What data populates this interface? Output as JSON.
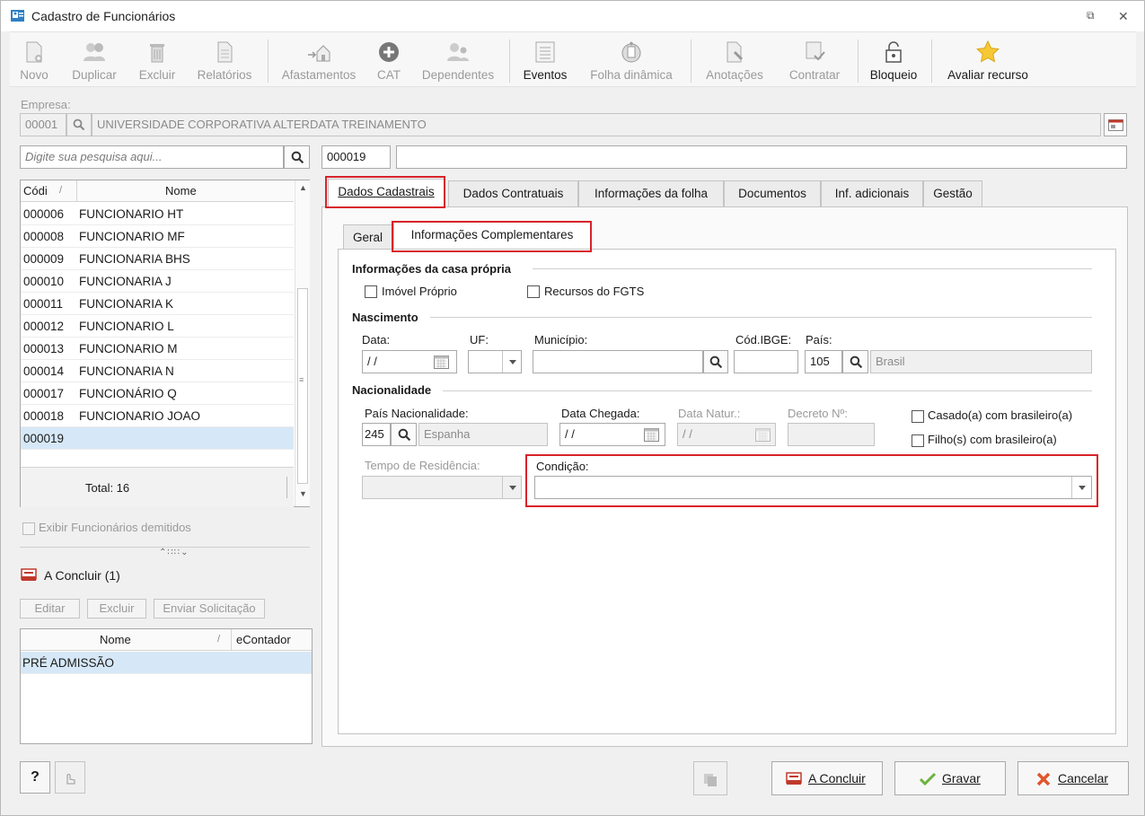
{
  "window": {
    "title": "Cadastro de Funcionários",
    "colors": {
      "accent_red": "#d8232a",
      "selected_row": "#d6e8f7"
    }
  },
  "toolbar": {
    "novo": "Novo",
    "duplicar": "Duplicar",
    "excluir": "Excluir",
    "relatorios": "Relatórios",
    "afastamentos": "Afastamentos",
    "cat": "CAT",
    "dependentes": "Dependentes",
    "eventos": "Eventos",
    "folha_dinamica": "Folha dinâmica",
    "anotacoes": "Anotações",
    "contratar": "Contratar",
    "bloqueio": "Bloqueio",
    "avaliar_recurso": "Avaliar recurso"
  },
  "empresa": {
    "label": "Empresa:",
    "code": "00001",
    "name": "UNIVERSIDADE CORPORATIVA ALTERDATA TREINAMENTO"
  },
  "search": {
    "placeholder": "Digite sua pesquisa aqui..."
  },
  "employee": {
    "code": "000019",
    "name": ""
  },
  "list": {
    "col_code": "Códi",
    "col_sort": "/",
    "col_name": "Nome",
    "rows": [
      {
        "code": "000006",
        "name": "FUNCIONARIO HT"
      },
      {
        "code": "000008",
        "name": "FUNCIONARIO MF"
      },
      {
        "code": "000009",
        "name": "FUNCIONARIA BHS"
      },
      {
        "code": "000010",
        "name": "FUNCIONARIA J"
      },
      {
        "code": "000011",
        "name": "FUNCIONARIA K"
      },
      {
        "code": "000012",
        "name": "FUNCIONARIO L"
      },
      {
        "code": "000013",
        "name": "FUNCIONARIO M"
      },
      {
        "code": "000014",
        "name": "FUNCIONARIA N"
      },
      {
        "code": "000017",
        "name": "FUNCIONÁRIO Q"
      },
      {
        "code": "000018",
        "name": "FUNCIONARIO JOAO"
      },
      {
        "code": "000019",
        "name": ""
      }
    ],
    "total": "Total: 16"
  },
  "exibir_demitidos": "Exibir Funcionários demitidos",
  "a_concluir": {
    "title": "A Concluir (1)",
    "editar": "Editar",
    "excluir": "Excluir",
    "enviar": "Enviar Solicitação",
    "col_nome": "Nome",
    "col_sort": "/",
    "col_econtador": "eContador",
    "rows": [
      {
        "nome": "PRÉ ADMISSÃO",
        "econtador": ""
      }
    ]
  },
  "tabs": {
    "dados_cadastrais": "Dados Cadastrais",
    "dados_contratuais": "Dados Contratuais",
    "informacoes_folha": "Informações da folha",
    "documentos": "Documentos",
    "inf_adicionais": "Inf. adicionais",
    "gestao": "Gestão"
  },
  "subtabs": {
    "geral": "Geral",
    "info_comp": "Informações Complementares"
  },
  "casa_propria": {
    "title": "Informações da casa própria",
    "imovel": "Imóvel Próprio",
    "fgts": "Recursos do FGTS"
  },
  "nascimento": {
    "title": "Nascimento",
    "data_label": "Data:",
    "data_value": "/ /",
    "uf_label": "UF:",
    "municipio_label": "Município:",
    "ibge_label": "Cód.IBGE:",
    "pais_label": "País:",
    "pais_code": "105",
    "pais_name": "Brasil"
  },
  "nacionalidade": {
    "title": "Nacionalidade",
    "pais_label": "País Nacionalidade:",
    "pais_code": "245",
    "pais_name": "Espanha",
    "chegada_label": "Data Chegada:",
    "chegada_value": "/ /",
    "natur_label": "Data Natur.:",
    "natur_value": "/ /",
    "decreto_label": "Decreto Nº:",
    "casado": "Casado(a) com brasileiro(a)",
    "filhos": "Filho(s) com brasileiro(a)",
    "tempo_label": "Tempo de Residência:",
    "condicao_label": "Condição:"
  },
  "footer": {
    "help": "?",
    "a_concluir": "A Concluir",
    "gravar": "Gravar",
    "cancelar": "Cancelar"
  }
}
